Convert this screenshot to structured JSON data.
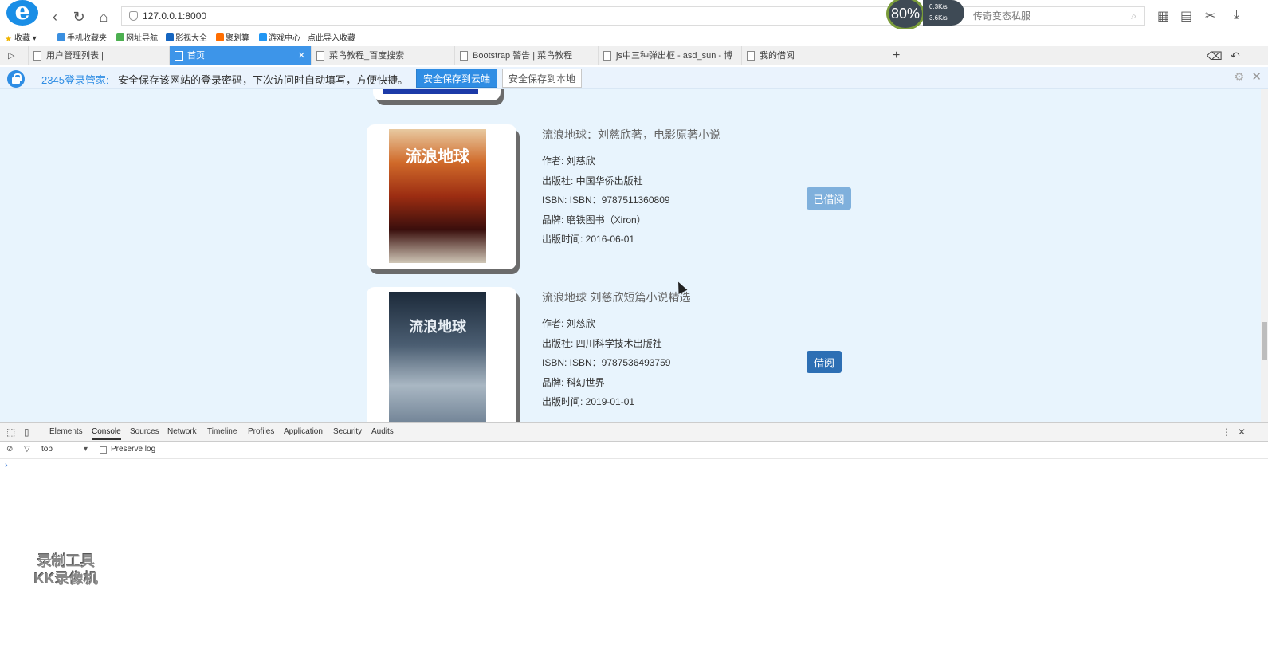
{
  "browser": {
    "address": "127.0.0.1:8000",
    "search_placeholder": "传奇变态私服",
    "speed_percent": "80%",
    "speed_up": "0.3K/s",
    "speed_down": "3.6K/s"
  },
  "favorites": [
    "收藏",
    "手机收藏夹",
    "网址导航",
    "影视大全",
    "聚划算",
    "游戏中心",
    "点此导入收藏"
  ],
  "tabs": [
    {
      "label": "用户管理列表 |"
    },
    {
      "label": "首页"
    },
    {
      "label": "菜鸟教程_百度搜索"
    },
    {
      "label": "Bootstrap 警告 | 菜鸟教程"
    },
    {
      "label": "js中三种弹出框 - asd_sun - 博"
    },
    {
      "label": "我的借阅"
    }
  ],
  "notice": {
    "brand": "2345登录管家:",
    "message": "安全保存该网站的登录密码，下次访问时自动填写，方便快捷。",
    "save_cloud": "安全保存到云端",
    "save_local": "安全保存到本地"
  },
  "books": [
    {
      "title": "流浪地球：刘慈欣著，电影原著小说",
      "author": "作者: 刘慈欣",
      "publisher": "出版社: 中国华侨出版社",
      "isbn": "ISBN: ISBN：9787511360809",
      "brand": "品牌: 磨铁图书（Xiron）",
      "date": "出版时间: 2016-06-01",
      "button": "已借阅",
      "cover_text": "流浪地球"
    },
    {
      "title": "流浪地球 刘慈欣短篇小说精选",
      "author": "作者: 刘慈欣",
      "publisher": "出版社: 四川科学技术出版社",
      "isbn": "ISBN: ISBN：9787536493759",
      "brand": "品牌: 科幻世界",
      "date": "出版时间: 2019-01-01",
      "button": "借阅",
      "cover_text": "流浪地球"
    }
  ],
  "devtools": {
    "tabs": [
      "Elements",
      "Console",
      "Sources",
      "Network",
      "Timeline",
      "Profiles",
      "Application",
      "Security",
      "Audits"
    ],
    "context": "top",
    "preserve_log": "Preserve log",
    "prompt": "›"
  },
  "watermark": {
    "line1": "录制工具",
    "line2": "KK录像机"
  }
}
